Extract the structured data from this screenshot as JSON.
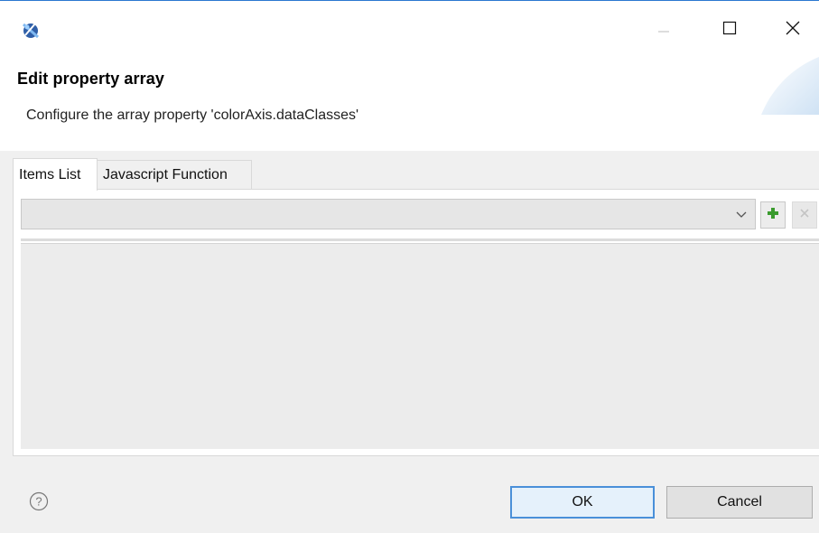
{
  "window": {
    "app_icon": "eclipse-birt-icon",
    "controls": {
      "minimize_icon": "minimize-icon",
      "maximize_icon": "maximize-icon",
      "close_icon": "close-icon"
    }
  },
  "header": {
    "title": "Edit property array",
    "description": "Configure the array property 'colorAxis.dataClasses'"
  },
  "tabs": [
    {
      "label": "Items List",
      "selected": true
    },
    {
      "label": "Javascript Function",
      "selected": false
    }
  ],
  "items_list": {
    "selector_value": "",
    "add_icon": "plus-icon",
    "remove_icon": "remove-icon",
    "items": []
  },
  "footer": {
    "help_icon": "help-icon",
    "ok_label": "OK",
    "cancel_label": "Cancel"
  },
  "colors": {
    "accent": "#4a90d9",
    "add_green": "#3a9b2e"
  }
}
